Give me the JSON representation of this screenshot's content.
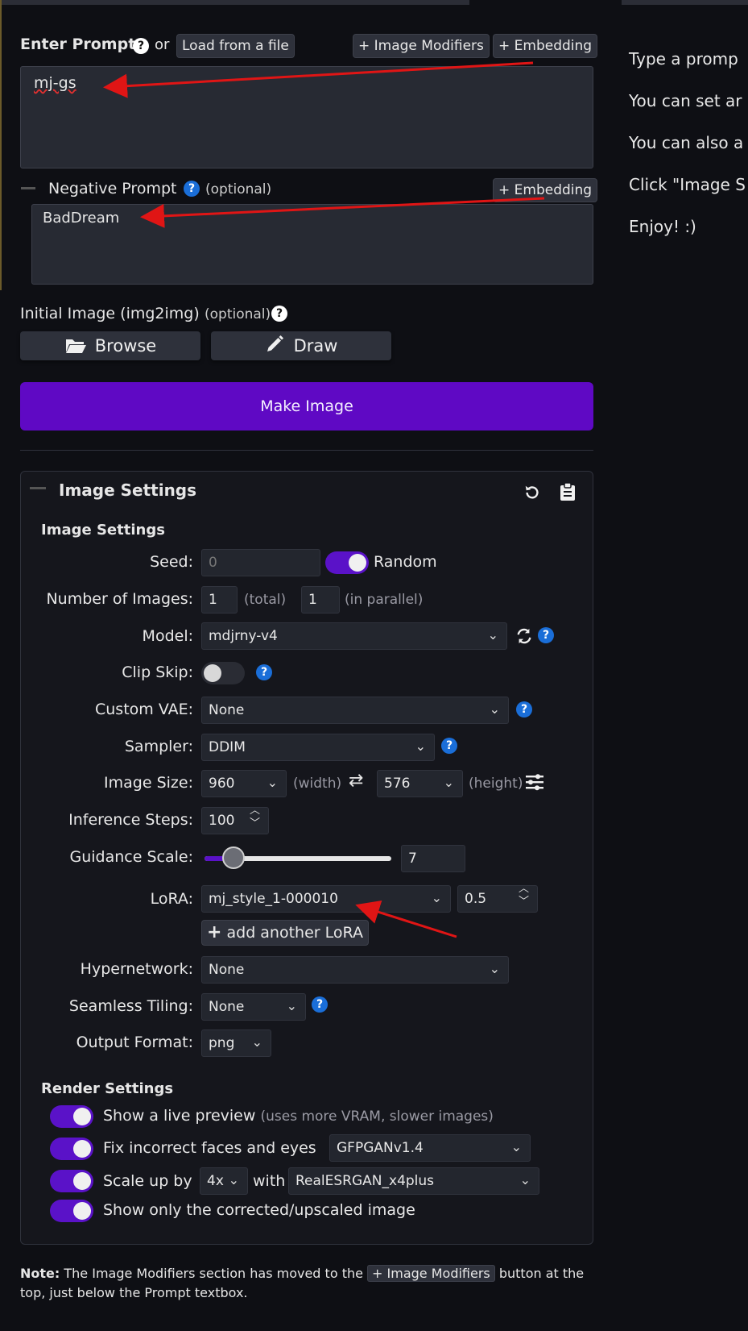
{
  "prompt": {
    "label": "Enter Prompt",
    "or_text": "or",
    "load_file": "Load from a file",
    "image_modifiers_button": "+ Image Modifiers",
    "embedding_button": "+ Embedding",
    "value": "mj-gs"
  },
  "negative_prompt": {
    "label": "Negative Prompt",
    "optional": "(optional)",
    "embedding_button": "+ Embedding",
    "value": "BadDream"
  },
  "initial_image": {
    "label": "Initial Image (img2img)",
    "optional": "(optional)",
    "browse": "Browse",
    "draw": "Draw"
  },
  "make_image": "Make Image",
  "image_settings": {
    "panel_title": "Image Settings",
    "section_title": "Image Settings",
    "seed": {
      "label": "Seed:",
      "value": "0",
      "random_label": "Random",
      "random_on": true
    },
    "num_images": {
      "label": "Number of Images:",
      "total": "1",
      "total_hint": "(total)",
      "parallel": "1",
      "parallel_hint": "(in parallel)"
    },
    "model": {
      "label": "Model:",
      "value": "mdjrny-v4"
    },
    "clip_skip": {
      "label": "Clip Skip:",
      "on": false
    },
    "custom_vae": {
      "label": "Custom VAE:",
      "value": "None"
    },
    "sampler": {
      "label": "Sampler:",
      "value": "DDIM"
    },
    "image_size": {
      "label": "Image Size:",
      "width": "960",
      "width_hint": "(width)",
      "height": "576",
      "height_hint": "(height)"
    },
    "inference_steps": {
      "label": "Inference Steps:",
      "value": "100"
    },
    "guidance_scale": {
      "label": "Guidance Scale:",
      "value": "7"
    },
    "lora": {
      "label": "LoRA:",
      "value": "mj_style_1-000010",
      "strength": "0.5",
      "add_button": "add another LoRA"
    },
    "hypernetwork": {
      "label": "Hypernetwork:",
      "value": "None"
    },
    "seamless_tiling": {
      "label": "Seamless Tiling:",
      "value": "None"
    },
    "output_format": {
      "label": "Output Format:",
      "value": "png"
    }
  },
  "render_settings": {
    "title": "Render Settings",
    "live_preview": {
      "label": "Show a live preview",
      "hint": "(uses more VRAM, slower images)"
    },
    "fix_faces": {
      "label": "Fix incorrect faces and eyes",
      "model": "GFPGANv1.4"
    },
    "upscale": {
      "label": "Scale up by",
      "factor": "4x",
      "with": "with",
      "model": "RealESRGAN_x4plus"
    },
    "show_corrected": {
      "label": "Show only the corrected/upscaled image"
    }
  },
  "note": {
    "bold": "Note:",
    "text1": "The Image Modifiers section has moved to the",
    "chip": "+ Image Modifiers",
    "text2": "button at the",
    "text3": "top, just below the Prompt textbox."
  },
  "help_panel": [
    "Type a promp",
    "You can set ar",
    "You can also a",
    "Click \"Image S",
    "Enjoy! :)"
  ],
  "colors": {
    "accent": "#5f09c4",
    "help_blue": "#1a6ed8",
    "annotation_red": "#e01515"
  }
}
